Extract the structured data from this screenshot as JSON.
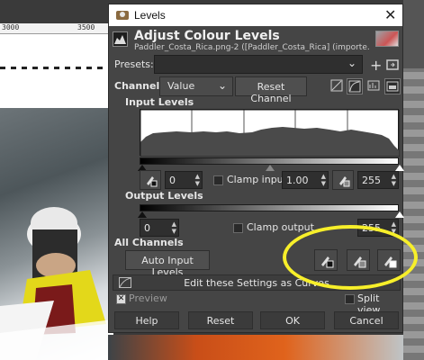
{
  "background": {
    "ruler_ticks": [
      "3000",
      "3500"
    ]
  },
  "dialog": {
    "window_title": "Levels",
    "header_title": "Adjust Colour Levels",
    "header_subtitle": "Paddler_Costa_Rica.png-2 ([Paddler_Costa_Rica] (importe...",
    "presets": {
      "label": "Presets:",
      "value": ""
    },
    "channel": {
      "label": "Channel:",
      "value": "Value",
      "reset_label": "Reset Channel"
    },
    "input_levels": {
      "label": "Input Levels",
      "low": "0",
      "gamma": "1.00",
      "high": "255",
      "clamp_label": "Clamp input"
    },
    "output_levels": {
      "label": "Output Levels",
      "low": "0",
      "high": "255",
      "clamp_label": "Clamp output"
    },
    "all_channels": {
      "label": "All Channels",
      "auto_label": "Auto Input Levels"
    },
    "edit_curves_label": "Edit these Settings as Curves",
    "preview_label": "Preview",
    "split_view_label": "Split view",
    "buttons": {
      "help": "Help",
      "reset": "Reset",
      "ok": "OK",
      "cancel": "Cancel"
    }
  },
  "colors": {
    "highlight": "#f7ef2a",
    "dialog_bg": "#454545",
    "field_bg": "#2f2f2f"
  }
}
